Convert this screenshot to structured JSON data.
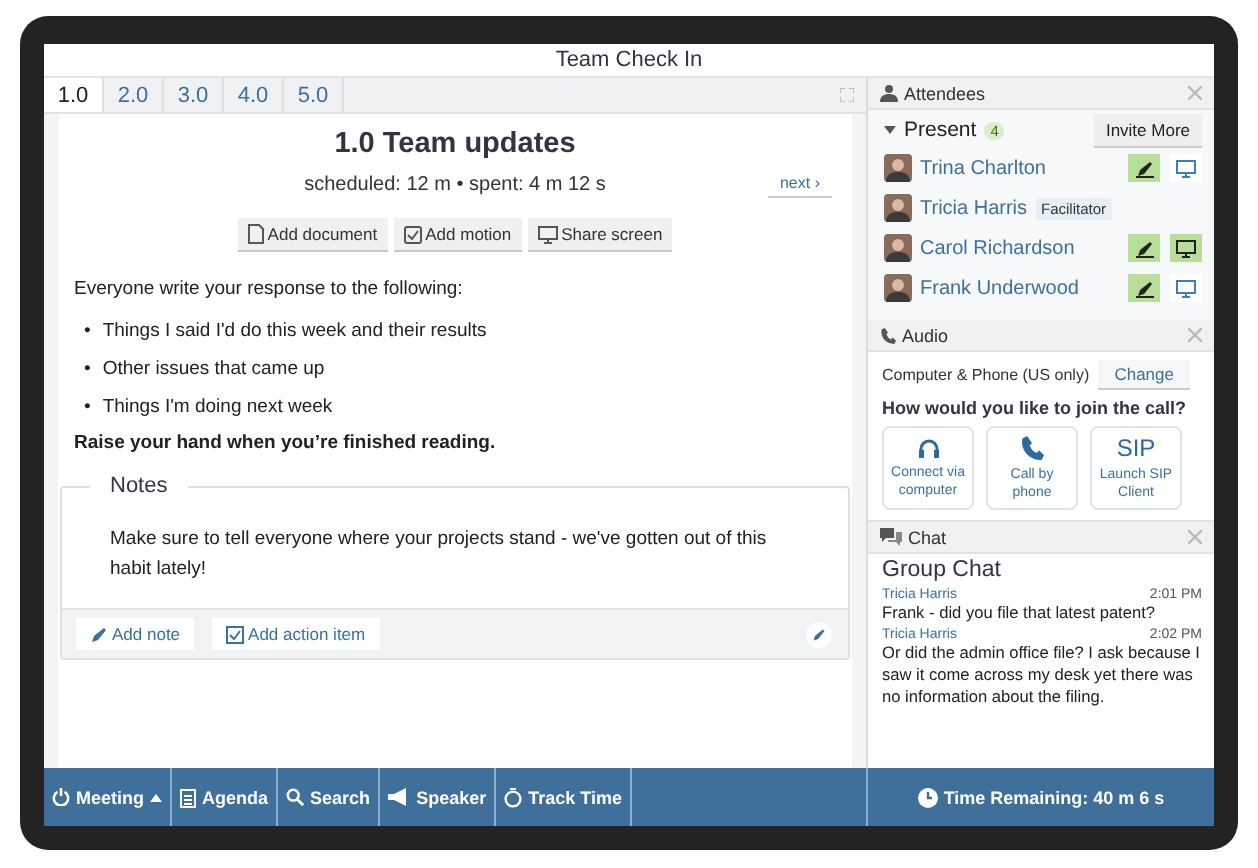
{
  "window": {
    "title": "Team Check In"
  },
  "tabs": [
    {
      "label": "1.0",
      "selected": true
    },
    {
      "label": "2.0",
      "selected": false
    },
    {
      "label": "3.0",
      "selected": false
    },
    {
      "label": "4.0",
      "selected": false
    },
    {
      "label": "5.0",
      "selected": false
    }
  ],
  "agenda_item": {
    "title": "1.0 Team updates",
    "timing": "scheduled: 12 m • spent: 4 m 12 s",
    "next": "next ›",
    "actions": [
      {
        "kind": "document",
        "label": "Add document"
      },
      {
        "kind": "motion",
        "label": "Add motion"
      },
      {
        "kind": "screen",
        "label": "Share screen"
      }
    ],
    "intro": "Everyone write your response to the following:",
    "bullets": [
      {
        "marker": "•",
        "text": "Things I said I'd do this week and their results"
      },
      {
        "marker": "•",
        "text": "Other issues that came up"
      },
      {
        "marker": "•",
        "text": "Things I'm doing next week"
      }
    ],
    "closing": "Raise your hand when you’re finished reading."
  },
  "notes": {
    "title": "Notes",
    "text": "Make sure to tell everyone where your projects stand - we've gotten out of this habit lately!",
    "actions": [
      {
        "kind": "note",
        "label": "Add note"
      },
      {
        "kind": "action",
        "label": "Add action item"
      }
    ]
  },
  "attendees": {
    "title": "Attendees",
    "group": "Present",
    "count": "4",
    "invite": "Invite More",
    "people": [
      {
        "name": "Trina Charlton",
        "edit_on": true,
        "screen_on": false
      },
      {
        "name": "Tricia Harris",
        "tag": "Facilitator"
      },
      {
        "name": "Carol Richardson",
        "edit_on": true,
        "screen_on": true
      },
      {
        "name": "Frank Underwood",
        "edit_on": true,
        "screen_on": false
      }
    ]
  },
  "audio": {
    "title": "Audio",
    "mode": "Computer & Phone (US only)",
    "change": "Change",
    "question": "How would you like to join the call?",
    "options": [
      {
        "kind": "headset",
        "label": "Connect via computer"
      },
      {
        "kind": "phone",
        "label": "Call by phone"
      },
      {
        "kind": "sip",
        "icon_text": "SIP",
        "label": "Launch SIP Client"
      }
    ]
  },
  "chat": {
    "title": "Chat",
    "heading": "Group Chat",
    "messages": [
      {
        "author": "Tricia Harris",
        "time": "2:01 PM",
        "text": "Frank - did you file that latest patent?"
      },
      {
        "author": "Tricia Harris",
        "time": "2:02 PM",
        "text": "Or did the admin office file? I ask because I saw it come across my desk yet there was no information about the filing."
      }
    ]
  },
  "bottom_bar": {
    "items": [
      {
        "kind": "meeting",
        "label": "Meeting"
      },
      {
        "kind": "agenda",
        "label": "Agenda"
      },
      {
        "kind": "search",
        "label": "Search"
      },
      {
        "kind": "speaker",
        "label": "Speaker"
      },
      {
        "kind": "timer",
        "label": "Track Time"
      }
    ],
    "time_remaining": "Time Remaining: 40 m 6 s"
  }
}
